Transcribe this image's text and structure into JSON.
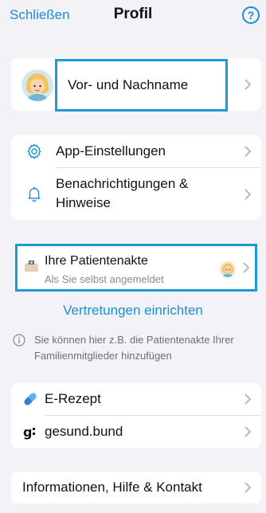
{
  "nav": {
    "close_label": "Schließen",
    "title": "Profil",
    "help_label": "?"
  },
  "profile": {
    "name_label": "Vor- und Nachname"
  },
  "settings": {
    "items": [
      {
        "label": "App-Einstellungen",
        "icon": "gear-icon"
      },
      {
        "label_line1": "Benachrichtigungen &",
        "label_line2": "Hinweise",
        "icon": "bell-icon"
      }
    ]
  },
  "patient_record": {
    "title": "Ihre Patientenakte",
    "subtitle": "Als Sie selbst angemeldet"
  },
  "representation_link": "Vertretungen einrichten",
  "info_note": "Sie können hier z.B. die Patientenakte Ihrer Familienmitglieder hinzufügen",
  "services": [
    {
      "label": "E-Rezept",
      "icon": "pill-icon"
    },
    {
      "label": "gesund.bund",
      "icon": "gesund-bund-logo"
    }
  ],
  "info_contact": {
    "label": "Informationen, Hilfe & Kontakt"
  },
  "colors": {
    "accent": "#1a8fd6",
    "highlight_border": "#1b9ad6",
    "background": "#f2f2f7"
  }
}
